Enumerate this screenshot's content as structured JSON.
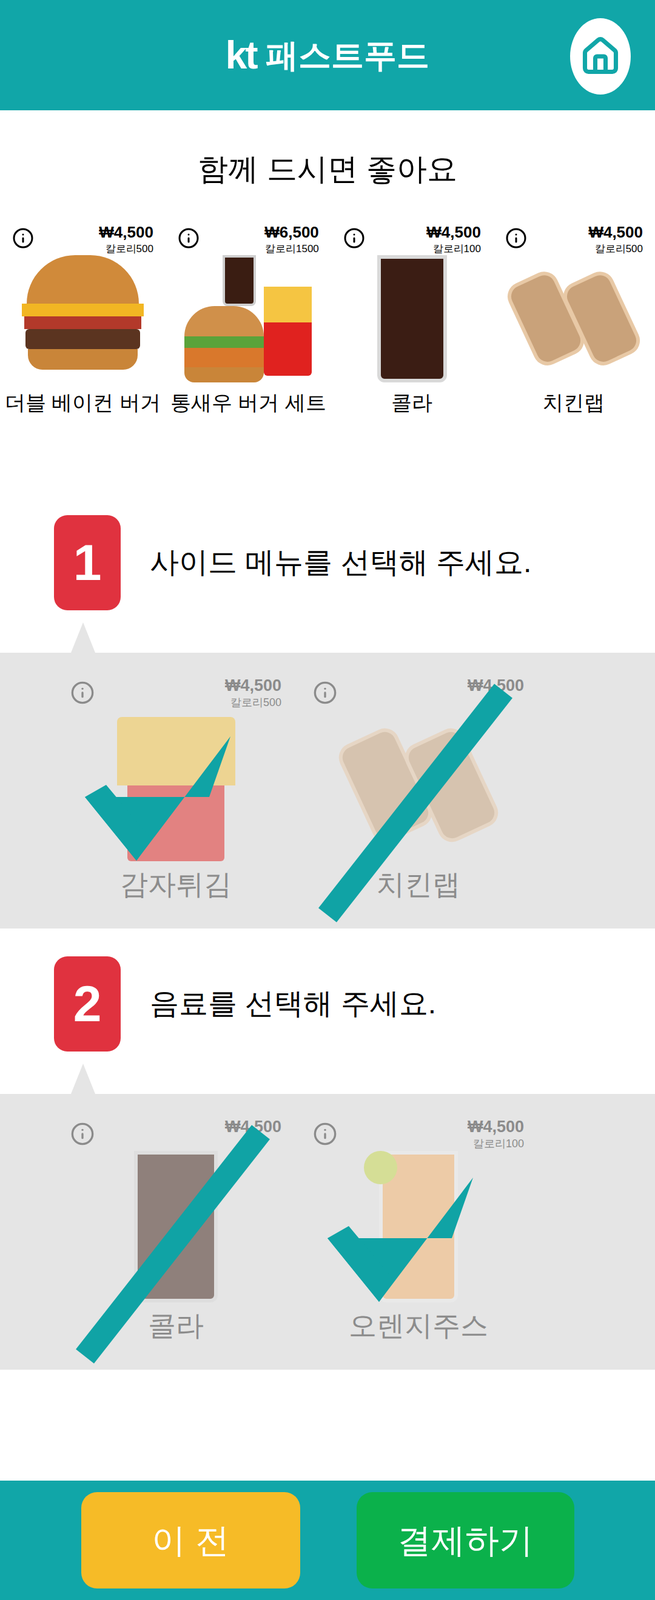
{
  "header": {
    "logo": "kt",
    "title": "패스트푸드"
  },
  "recommend": {
    "title": "함께 드시면 좋아요",
    "items": [
      {
        "name": "더블 베이컨 버거",
        "price": "₩4,500",
        "calories": "칼로리500",
        "kind": "burger"
      },
      {
        "name": "통새우 버거 세트",
        "price": "₩6,500",
        "calories": "칼로리1500",
        "kind": "set"
      },
      {
        "name": "콜라",
        "price": "₩4,500",
        "calories": "칼로리100",
        "kind": "cola"
      },
      {
        "name": "치킨랩",
        "price": "₩4,500",
        "calories": "칼로리500",
        "kind": "wrap"
      }
    ]
  },
  "sections": [
    {
      "number": "1",
      "title": "사이드 메뉴를 선택해 주세요.",
      "options": [
        {
          "name": "감자튀김",
          "price": "₩4,500",
          "calories": "칼로리500",
          "kind": "fries",
          "selected": true
        },
        {
          "name": "치킨랩",
          "price": "₩4,500",
          "calories": "",
          "kind": "wrap",
          "selected": false
        }
      ]
    },
    {
      "number": "2",
      "title": "음료를 선택해 주세요.",
      "options": [
        {
          "name": "콜라",
          "price": "₩4,500",
          "calories": "",
          "kind": "cola",
          "selected": false
        },
        {
          "name": "오렌지주스",
          "price": "₩4,500",
          "calories": "칼로리100",
          "kind": "juice",
          "selected": true
        }
      ]
    }
  ],
  "buttons": {
    "back": "이 전",
    "pay": "결제하기"
  }
}
